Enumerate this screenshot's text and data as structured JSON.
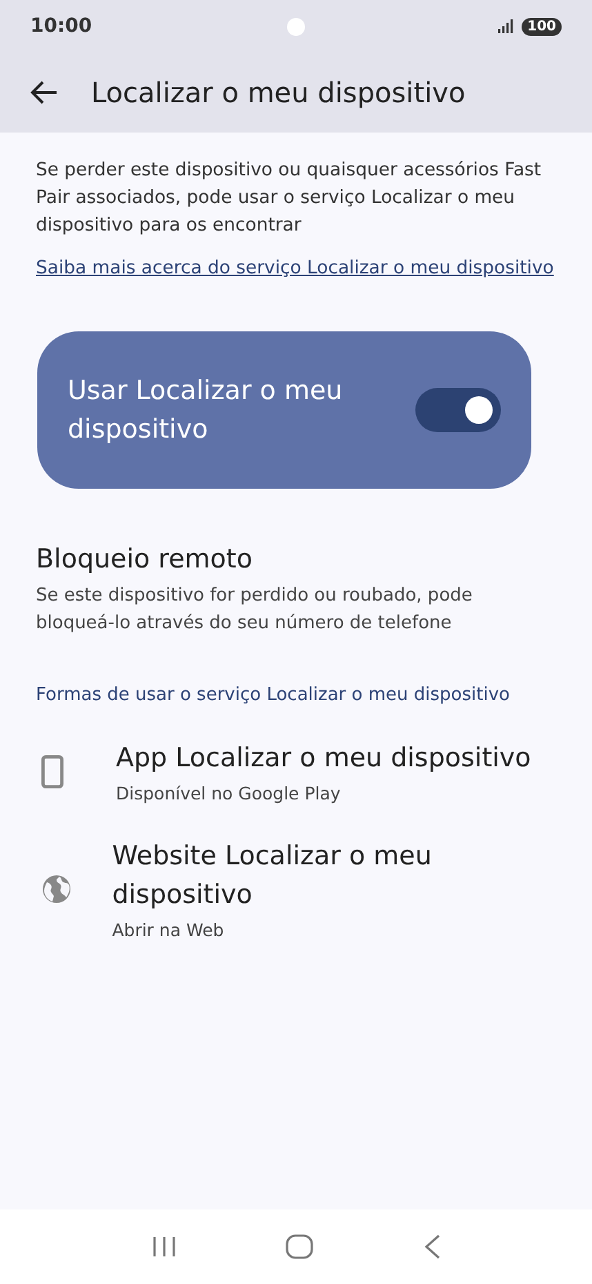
{
  "status_bar": {
    "time": "10:00",
    "battery": "100"
  },
  "app_bar": {
    "title": "Localizar o meu dispositivo"
  },
  "intro": "Se perder este dispositivo ou quaisquer acessórios Fast Pair associados, pode usar o serviço Localizar o meu dispositivo para os encontrar",
  "learn_more_link": "Saiba mais acerca do serviço Localizar o meu dispositivo",
  "main_switch": {
    "label": "Usar Localizar o meu dispositivo",
    "on": true
  },
  "remote_lock": {
    "title": "Bloqueio remoto",
    "summary": "Se este dispositivo for perdido ou roubado, pode bloqueá-lo através do seu número de telefone"
  },
  "ways_header": "Formas de usar o serviço Localizar o meu dispositivo",
  "ways": [
    {
      "kind": "app",
      "title": "App Localizar o meu dispositivo",
      "summary": "Disponível no Google Play"
    },
    {
      "kind": "web",
      "title": "Website Localizar o meu dispositivo",
      "summary": "Abrir na Web"
    }
  ]
}
